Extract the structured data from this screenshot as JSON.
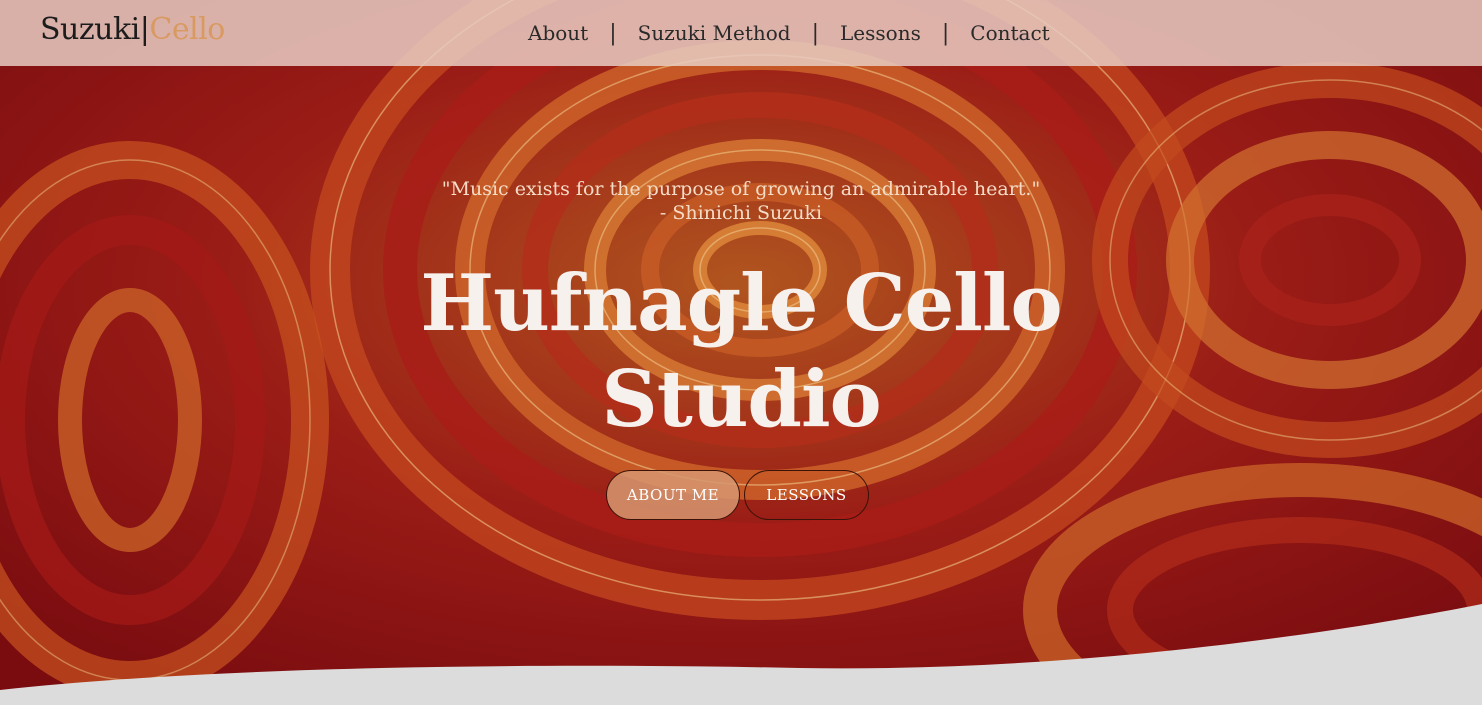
{
  "brand": {
    "part1": "Suzuki",
    "separator": "|",
    "part2": "Cello"
  },
  "nav": [
    {
      "label": "About"
    },
    {
      "label": "Suzuki Method"
    },
    {
      "label": "Lessons"
    },
    {
      "label": "Contact"
    }
  ],
  "nav_separator": "|",
  "hero": {
    "quote": "\"Music exists for the purpose of growing an admirable heart.\"",
    "author": "- Shinichi Suzuki",
    "title_line1": "Hufnagle Cello",
    "title_line2": "Studio",
    "primary_button": "ABOUT ME",
    "secondary_button": "LESSONS"
  },
  "colors": {
    "navbar": "#e8cdc3",
    "brand_accent": "#d99a62",
    "hero_red": "#8e1016",
    "hero_orange": "#d4662a",
    "wave": "#dcdcdc"
  }
}
